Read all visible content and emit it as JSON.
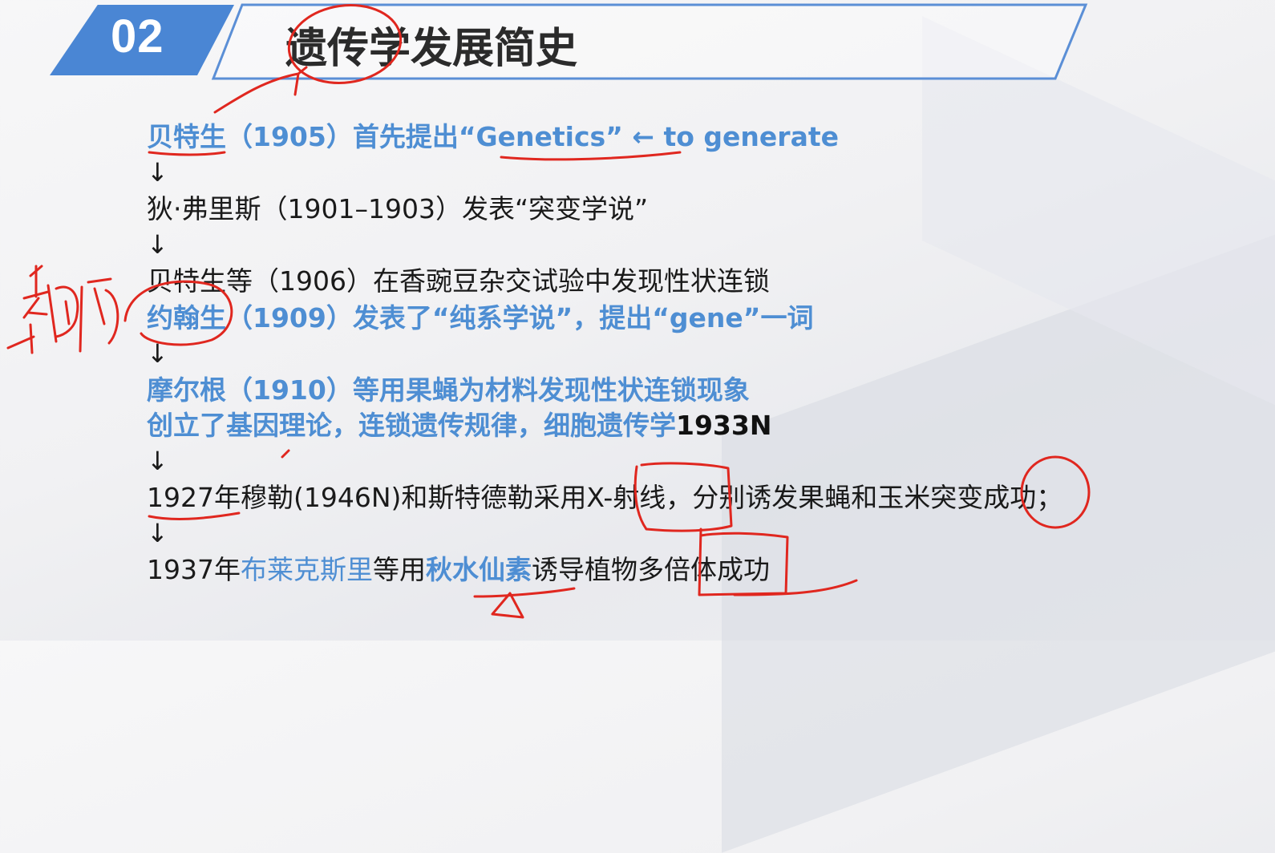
{
  "header": {
    "number": "02",
    "title": "遗传学发展简史"
  },
  "timeline": {
    "arrow": "↓",
    "line1": {
      "text": "贝特生（1905）首先提出“Genetics” ← to generate"
    },
    "line2": {
      "text": "狄·弗里斯（1901–1903）发表“突变学说”"
    },
    "line3": {
      "text": "贝特生等（1906）在香豌豆杂交试验中发现性状连锁"
    },
    "line4": {
      "text": "约翰生（1909）发表了“纯系学说”，提出“gene”一词"
    },
    "line5": {
      "text": "摩尔根（1910）等用果蝇为材料发现性状连锁现象"
    },
    "line6": {
      "highlight": "创立了基因理论，连锁遗传规律，细胞遗传学",
      "suffix": "1933N"
    },
    "line7": {
      "text": "1927年穆勒(1946N)和斯特德勒采用X-射线，分别诱发果蝇和玉米突变成功；"
    },
    "line8": {
      "part1": "1937年",
      "part2": "布莱克斯里",
      "part3": "等用",
      "part4": "秋水仙素",
      "part5": "诱导植物多倍体成功"
    }
  },
  "colors": {
    "accent_blue": "#4e8ed3",
    "badge_blue": "#4a86d4",
    "annotation_red": "#e0271f"
  }
}
